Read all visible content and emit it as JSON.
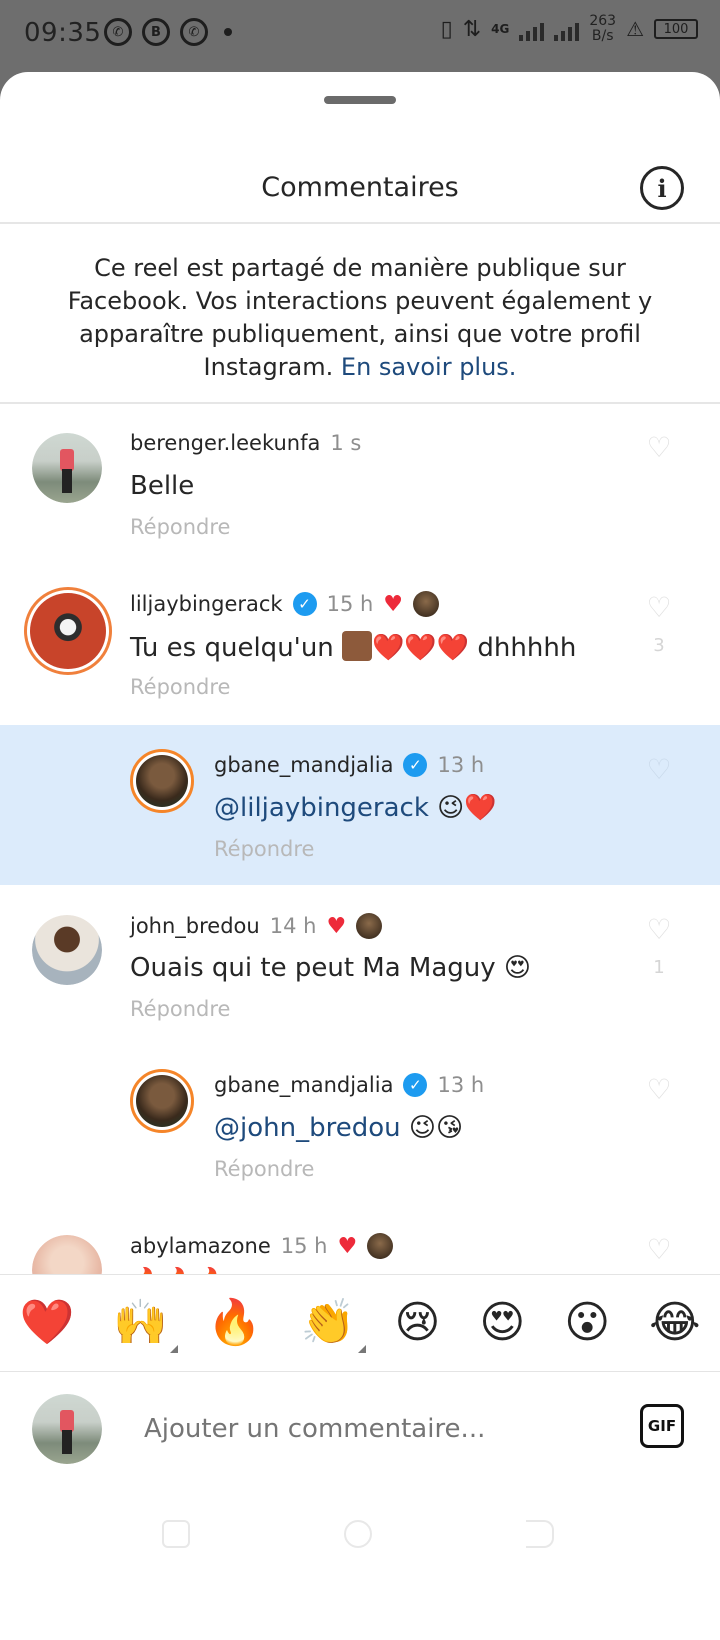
{
  "status_bar": {
    "time": "09:35",
    "network": "4G",
    "speed_value": "263",
    "speed_unit": "B/s",
    "battery": "100"
  },
  "header": {
    "title": "Commentaires"
  },
  "notice": {
    "text": "Ce reel est partagé de manière publique sur Facebook. Vos interactions peuvent également y apparaître publiquement, ainsi que votre profil Instagram.",
    "link": "En savoir plus."
  },
  "comments": [
    {
      "username": "berenger.leekunfa",
      "time": "1 s",
      "text": "Belle",
      "reply": "Répondre"
    },
    {
      "username": "liljaybingerack",
      "time": "15 h",
      "text_a": "Tu es quelqu'un",
      "text_b": "❤️❤️❤️ dhhhhh",
      "reply": "Répondre",
      "likes": "3"
    },
    {
      "username": "gbane_mandjalia",
      "time": "13 h",
      "mention": "@liljaybingerack",
      "text": " 😉❤️",
      "reply": "Répondre"
    },
    {
      "username": "john_bredou",
      "time": "14 h",
      "text": "Ouais qui te peut Ma Maguy 😍",
      "reply": "Répondre",
      "likes": "1"
    },
    {
      "username": "gbane_mandjalia",
      "time": "13 h",
      "mention": "@john_bredou",
      "text": " 😉😘",
      "reply": "Répondre"
    },
    {
      "username": "abylamazone",
      "time": "15 h",
      "text": "🔥🔥🔥"
    }
  ],
  "emoji_bar": [
    "❤️",
    "🙌",
    "🔥",
    "👏",
    "😢",
    "😍",
    "😮",
    "😂"
  ],
  "input": {
    "placeholder": "Ajouter un commentaire...",
    "gif_label": "GIF"
  }
}
